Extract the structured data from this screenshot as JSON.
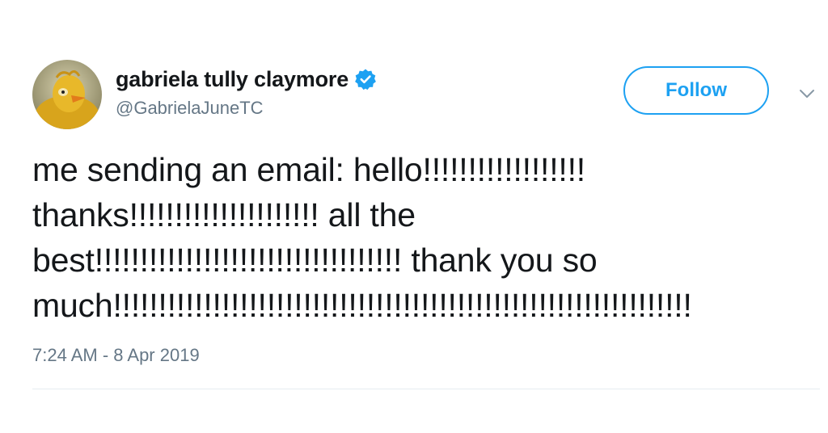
{
  "user": {
    "display_name": "gabriela tully claymore",
    "handle": "@GabrielaJuneTC",
    "verified": true
  },
  "actions": {
    "follow_label": "Follow",
    "more_icon": "chevron-down-icon"
  },
  "tweet": {
    "lines": [
      "me sending an email: hello!!!!!!!!!!!!!!!!!!",
      "thanks!!!!!!!!!!!!!!!!!!!!! all the",
      "best!!!!!!!!!!!!!!!!!!!!!!!!!!!!!!!!!! thank you so",
      "much!!!!!!!!!!!!!!!!!!!!!!!!!!!!!!!!!!!!!!!!!!!!!!!!!!!!!!!!!!!!!!!!"
    ],
    "timestamp": "7:24 AM - 8 Apr 2019"
  },
  "colors": {
    "accent": "#1da1f2",
    "text_primary": "#14171a",
    "text_secondary": "#657786",
    "divider": "#e6ecf0"
  }
}
